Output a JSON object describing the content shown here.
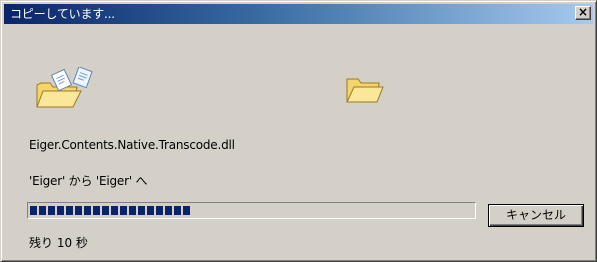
{
  "window": {
    "title": "コピーしています...",
    "close_glyph": "×"
  },
  "icons": {
    "source": "folder-with-flying-documents-icon",
    "destination": "open-folder-icon"
  },
  "file": {
    "name": "Eiger.Contents.Native.Transcode.dll"
  },
  "transfer": {
    "from_to": "'Eiger' から 'Eiger' へ",
    "progress_fraction": 0.37,
    "remaining": "残り 10 秒"
  },
  "buttons": {
    "cancel_label": "キャンセル"
  },
  "colors": {
    "title_start": "#0a246a",
    "title_end": "#a6caf0",
    "face": "#d4d0c8",
    "progress_block": "#0a246a"
  }
}
